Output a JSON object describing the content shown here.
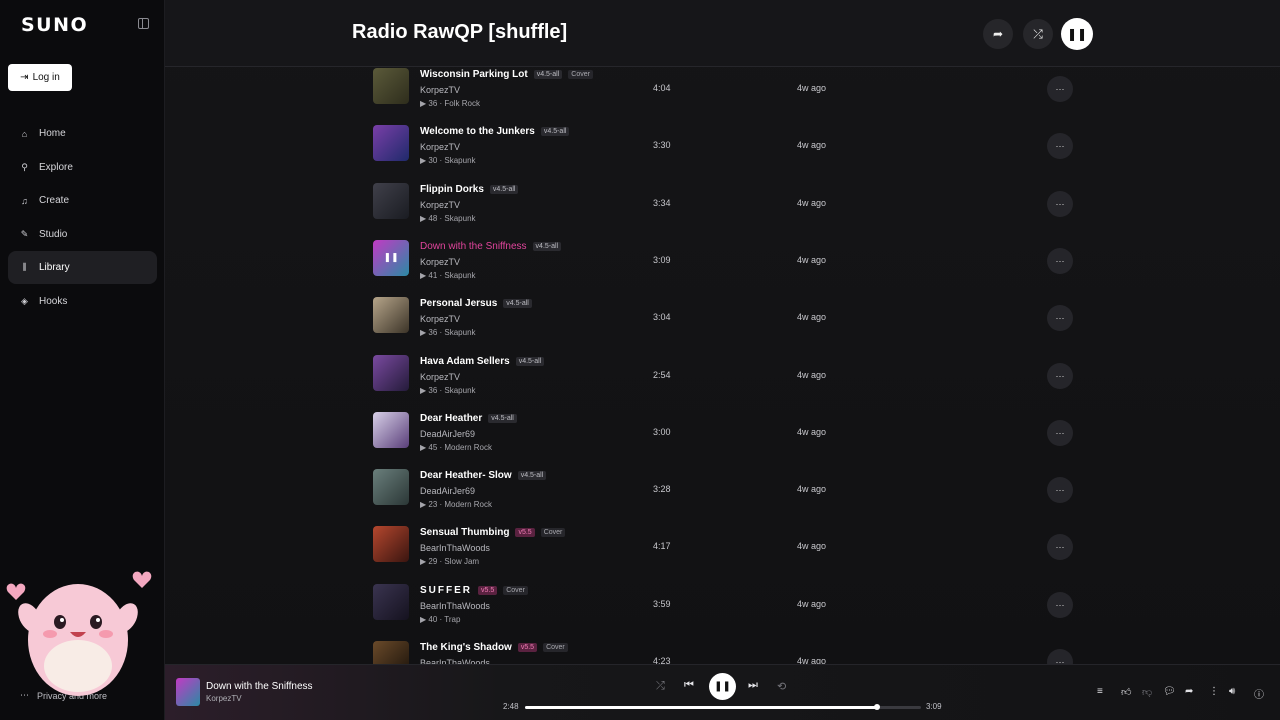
{
  "sidebar": {
    "logo": "SUNO",
    "login_label": "Log in",
    "nav": [
      {
        "label": "Home",
        "icon": "home-icon",
        "active": false
      },
      {
        "label": "Explore",
        "icon": "search-icon",
        "active": false
      },
      {
        "label": "Create",
        "icon": "music-note-icon",
        "active": false
      },
      {
        "label": "Studio",
        "icon": "studio-icon",
        "active": false
      },
      {
        "label": "Library",
        "icon": "library-icon",
        "active": true
      },
      {
        "label": "Hooks",
        "icon": "hooks-icon",
        "active": false
      }
    ],
    "privacy_label": "Privacy and more"
  },
  "header": {
    "title": "Radio RawQP [shuffle]"
  },
  "tracks": [
    {
      "title": "Wisconsin Parking Lot",
      "version": "v4.5-all",
      "cover": "Cover",
      "artist": "KorpezTV",
      "plays": "36",
      "genre": "Folk Rock",
      "duration": "4:04",
      "age": "4w ago",
      "thumb": [
        "#5b5a3a",
        "#2e2d1c"
      ]
    },
    {
      "title": "Welcome to the Junkers",
      "version": "v4.5-all",
      "cover": "",
      "artist": "KorpezTV",
      "plays": "30",
      "genre": "Skapunk",
      "duration": "3:30",
      "age": "4w ago",
      "thumb": [
        "#7a3fa8",
        "#1f2a6b"
      ]
    },
    {
      "title": "Flippin Dorks",
      "version": "v4.5-all",
      "cover": "",
      "artist": "KorpezTV",
      "plays": "48",
      "genre": "Skapunk",
      "duration": "3:34",
      "age": "4w ago",
      "thumb": [
        "#40404a",
        "#1a1c22"
      ]
    },
    {
      "title": "Down with the Sniffness",
      "version": "v4.5-all",
      "cover": "",
      "artist": "KorpezTV",
      "plays": "41",
      "genre": "Skapunk",
      "duration": "3:09",
      "age": "4w ago",
      "thumb": [
        "#c23ac4",
        "#2a8aa4"
      ],
      "playing": true
    },
    {
      "title": "Personal Jersus",
      "version": "v4.5-all",
      "cover": "",
      "artist": "KorpezTV",
      "plays": "36",
      "genre": "Skapunk",
      "duration": "3:04",
      "age": "4w ago",
      "thumb": [
        "#b6a58a",
        "#3c3428"
      ]
    },
    {
      "title": "Hava Adam Sellers",
      "version": "v4.5-all",
      "cover": "",
      "artist": "KorpezTV",
      "plays": "36",
      "genre": "Skapunk",
      "duration": "2:54",
      "age": "4w ago",
      "thumb": [
        "#7a4aa0",
        "#241b3a"
      ]
    },
    {
      "title": "Dear Heather",
      "version": "v4.5-all",
      "cover": "",
      "artist": "DeadAirJer69",
      "plays": "45",
      "genre": "Modern Rock",
      "duration": "3:00",
      "age": "4w ago",
      "thumb": [
        "#d8d0e8",
        "#5a3f7a"
      ]
    },
    {
      "title": "Dear Heather- Slow",
      "version": "v4.5-all",
      "cover": "",
      "artist": "DeadAirJer69",
      "plays": "23",
      "genre": "Modern Rock",
      "duration": "3:28",
      "age": "4w ago",
      "thumb": [
        "#6a7f7c",
        "#2b3736"
      ]
    },
    {
      "title": "Sensual Thumbing",
      "version": "v5.5",
      "cover": "Cover",
      "artist": "BearInThaWoods",
      "plays": "29",
      "genre": "Slow Jam",
      "duration": "4:17",
      "age": "4w ago",
      "thumb": [
        "#b5472e",
        "#3a1510"
      ]
    },
    {
      "title": "SUFFER",
      "version": "v5.5",
      "cover": "Cover",
      "artist": "BearInThaWoods",
      "plays": "40",
      "genre": "Trap",
      "duration": "3:59",
      "age": "4w ago",
      "thumb": [
        "#3a3450",
        "#15121f"
      ]
    },
    {
      "title": "The King's Shadow",
      "version": "v5.5",
      "cover": "Cover",
      "artist": "BearInThaWoods",
      "plays": "",
      "genre": "",
      "duration": "4:23",
      "age": "4w ago",
      "thumb": [
        "#6a4a2a",
        "#1a120a"
      ]
    }
  ],
  "player": {
    "title": "Down with the Sniffness",
    "artist": "KorpezTV",
    "elapsed": "2:48",
    "total": "3:09",
    "progress": 0.889
  }
}
